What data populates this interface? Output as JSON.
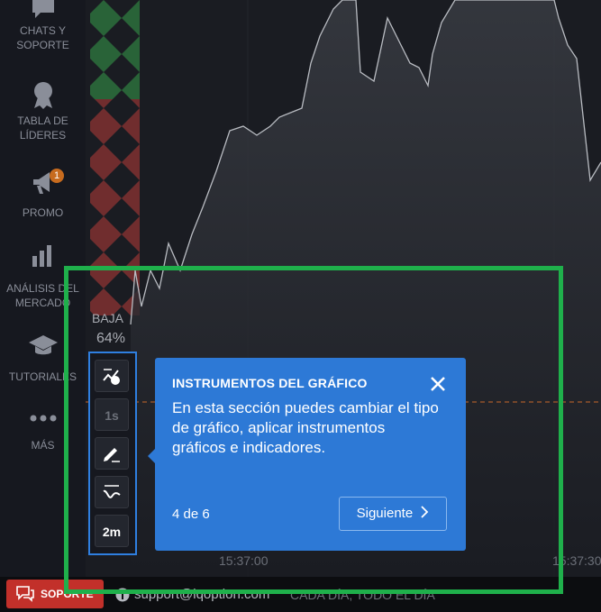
{
  "sidebar": {
    "items": [
      {
        "label": "CHATS Y SOPORTE",
        "icon": "chat-icon"
      },
      {
        "label": "TABLA DE LÍDERES",
        "icon": "medal-icon"
      },
      {
        "label": "PROMO",
        "icon": "megaphone-icon",
        "badge": "1"
      },
      {
        "label": "ANÁLISIS DEL MERCADO",
        "icon": "bar-chart-icon"
      },
      {
        "label": "TUTORIALES",
        "icon": "graduation-cap-icon"
      },
      {
        "label": "MÁS",
        "icon": "more-dots-icon"
      }
    ]
  },
  "chart": {
    "direction_label": "BAJA",
    "direction_pct": "64%",
    "time_labels": [
      "15:37:00",
      "15:37:30"
    ]
  },
  "toolbar": {
    "timeframe": "1s",
    "expiry": "2m"
  },
  "tooltip": {
    "title": "INSTRUMENTOS DEL GRÁFICO",
    "body": "En esta sección puedes cambiar el tipo de gráfico, aplicar instrumentos gráficos e indicadores.",
    "step": "4 de 6",
    "next_label": "Siguiente"
  },
  "footer": {
    "support_label": "SOPORTE",
    "email": "support@iqoption.com",
    "tagline": "CADA DÍA, TODO EL DÍA"
  },
  "colors": {
    "accent_blue": "#2d79d6",
    "highlight_green": "#1fb04b",
    "support_red": "#c2302a",
    "badge_orange": "#c76b1e"
  }
}
